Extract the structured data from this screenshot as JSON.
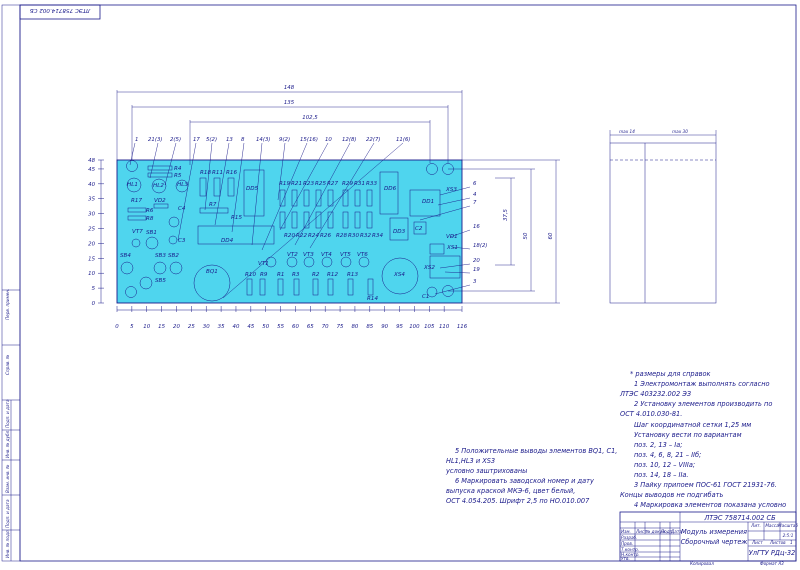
{
  "sheet": {
    "rotated_code": "ЛТЭС 758714.002 СБ",
    "colors": {
      "line": "#1a1a8a",
      "board": "#4fd5ee",
      "background": "#ffffff"
    }
  },
  "dimensions": {
    "overall_148": "148",
    "hole_pitch_135": "135",
    "span_102_5": "102,5",
    "height_60": "60",
    "height_50": "50",
    "height_37_5": "37,5",
    "side_14": "max 14",
    "side_30": "max 30"
  },
  "axes": {
    "x_ticks": [
      "0",
      "5",
      "10",
      "15",
      "20",
      "25",
      "30",
      "35",
      "40",
      "45",
      "50",
      "55",
      "60",
      "65",
      "70",
      "75",
      "80",
      "85",
      "90",
      "95",
      "100",
      "105",
      "110",
      "116"
    ],
    "y_ticks": [
      "0",
      "5",
      "10",
      "15",
      "20",
      "25",
      "30",
      "35",
      "40",
      "45",
      "48"
    ]
  },
  "leaders": {
    "top": [
      "1",
      "21(3)",
      "2(5)",
      "17",
      "5(2)",
      "13",
      "8",
      "14(3)",
      "9(2)",
      "15(16)",
      "10",
      "12(8)",
      "22(7)",
      "11(6)"
    ],
    "right": [
      "6",
      "4",
      "7",
      "16",
      "18(2)",
      "20",
      "19",
      "3"
    ]
  },
  "components": {
    "HL1": "HL1",
    "HL2": "HL2",
    "HL3": "HL3",
    "R4": "R4",
    "R5": "R5",
    "R17": "R17",
    "R6": "R6",
    "R8": "R8",
    "VD2": "VD2",
    "C4": "C4",
    "C3": "C3",
    "VT7": "VT7",
    "SB1": "SB1",
    "SB4": "SB4",
    "SB3": "SB3",
    "SB2": "SB2",
    "SB5": "SB5",
    "R18": "R18",
    "R11": "R11",
    "R16": "R16",
    "R7": "R7",
    "R15": "R15",
    "DD4": "DD4",
    "BQ1": "BQ1",
    "DD5": "DD5",
    "R19": "R19",
    "R21": "R21",
    "R23": "R23",
    "R25": "R25",
    "R27": "R27",
    "R29": "R29",
    "R31": "R31",
    "R33": "R33",
    "R20": "R20",
    "R22": "R22",
    "R24": "R24",
    "R26": "R26",
    "R28": "R28",
    "R30": "R30",
    "R32": "R32",
    "R34": "R34",
    "DD6": "DD6",
    "XS3": "XS3",
    "DD1": "DD1",
    "DD3": "DD3",
    "C2": "C2",
    "VD1": "VD1",
    "XS1": "XS1",
    "XS2": "XS2",
    "XS4": "XS4",
    "C1": "C1",
    "VT1": "VT1",
    "VT2": "VT2",
    "VT3": "VT3",
    "VT4": "VT4",
    "VT5": "VT5",
    "VT6": "VT6",
    "R10": "R10",
    "R9": "R9",
    "R1": "R1",
    "R3": "R3",
    "R2": "R2",
    "R12": "R12",
    "R13": "R13",
    "R14": "R14"
  },
  "notes": {
    "right": [
      "* размеры для справок",
      "1 Электромонтаж выполнять согласно",
      "ЛТЭС 403232.002 ЭЗ",
      "2 Установку элементов производить по",
      "ОСТ 4.010.030-81.",
      "Шаг координатной сетки 1,25 мм",
      "Установку вести по вариантам",
      "поз. 2, 13 – Iа;",
      "поз. 4, 6, 8, 21 – IIб;",
      "поз. 10, 12 – VIIIа;",
      "поз. 14, 18 – IIа.",
      "3 Пайку припоем ПОС-61 ГОСТ 21931-76.",
      "Концы выводов не подгибать",
      "4 Маркировка элементов показана условно"
    ],
    "left": [
      "5 Положительные выводы элементов BQ1, C1,",
      "HL1,HL3 и XS3",
      "условно заштрихованы",
      "6 Маркировать заводской номер и дату",
      "выпуска краской МКЭ-6, цвет белый,",
      "ОСТ 4.054.205. Шрифт 2,5 по НО.010.007"
    ]
  },
  "title_block": {
    "code": "ЛТЭС 758714.002 СБ",
    "name_line1": "Модуль измерения",
    "name_line2": "Сборочный чертеж",
    "org": "УлГТУ РДц-32",
    "lit_header": "Лит.",
    "mass_header": "Масса",
    "scale_header": "Масштаб",
    "scale_value": "2:5:1",
    "sheet_label": "Лист",
    "sheets_label": "Листов",
    "sheets_value": "1",
    "rows": [
      "Изм.",
      "Лист",
      "№ докум.",
      "Подп.",
      "Дата",
      "Разраб.",
      "Пров.",
      "Т.контр.",
      "Н.контр.",
      "Утв."
    ],
    "copied": "Копировал",
    "format": "Формат А3"
  },
  "left_margin": {
    "cells": [
      "Перв. примен.",
      "Справ. №",
      "Подп. и дата",
      "Инв. № дубл.",
      "Взам. инв. №",
      "Подп. и дата",
      "Инв. № подл."
    ]
  }
}
